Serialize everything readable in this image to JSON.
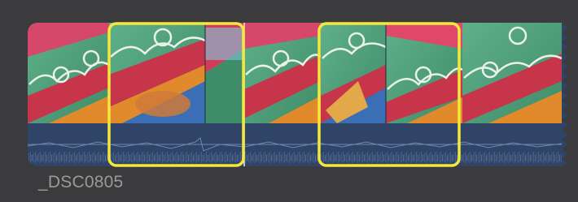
{
  "clip": {
    "name": "_DSC0805"
  },
  "filmstrip": {
    "frame_count": 6,
    "selection_count": 2
  },
  "colors": {
    "background": "#3b3b3d",
    "selection_outline": "#f4e83c",
    "audio_track": "#2f4466",
    "audio_waveform": "#8aa0c6",
    "frame_green": "#4a9a72",
    "frame_red": "#c7354a",
    "frame_orange": "#e08a2c",
    "frame_blue": "#3a6fb6",
    "label_text": "#9a9a9a"
  }
}
